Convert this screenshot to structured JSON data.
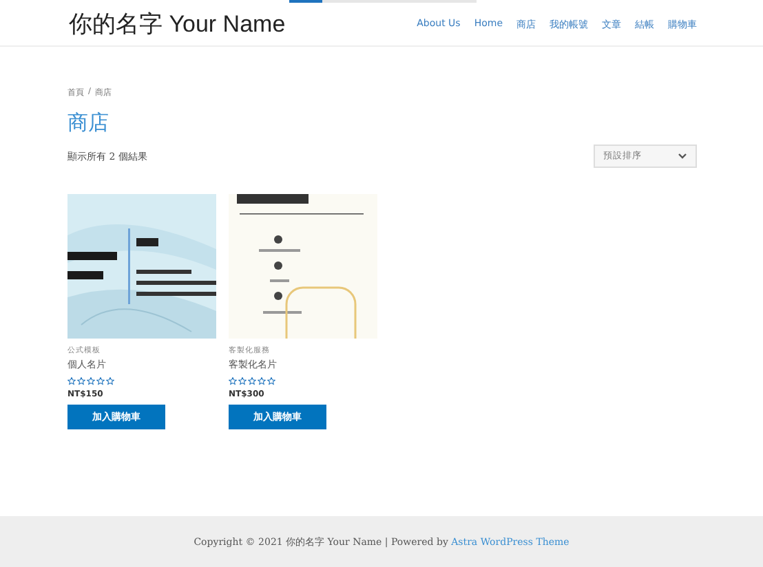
{
  "top_bar": {
    "level": 0.18
  },
  "header": {
    "site_title": "你的名字 Your Name",
    "nav": [
      {
        "label": "About Us",
        "selected": false
      },
      {
        "label": "Home",
        "selected": false
      },
      {
        "label": "商店",
        "selected": false
      },
      {
        "label": "我的帳號",
        "selected": false
      },
      {
        "label": "文章",
        "selected": false
      },
      {
        "label": "結帳",
        "selected": false
      },
      {
        "label": "購物車",
        "selected": false
      }
    ]
  },
  "breadcrumb": [
    "首頁",
    "商店"
  ],
  "breadcrumb_separator": "/",
  "page_title": "商店",
  "result_count": "顯示所有 2 個結果",
  "sort": {
    "value": "預設排序"
  },
  "products": [
    {
      "category": "公式模板",
      "name": "個人名片",
      "stars": 0,
      "price": "NT$150",
      "button": "加入購物車"
    },
    {
      "category": "客製化服務",
      "name": "客製化名片",
      "stars": 0,
      "price": "NT$300",
      "button": "加入購物車"
    }
  ],
  "footer": {
    "text": "Copyright © 2021 你的名字 Your Name | Powered by ",
    "link": "Astra WordPress Theme"
  }
}
